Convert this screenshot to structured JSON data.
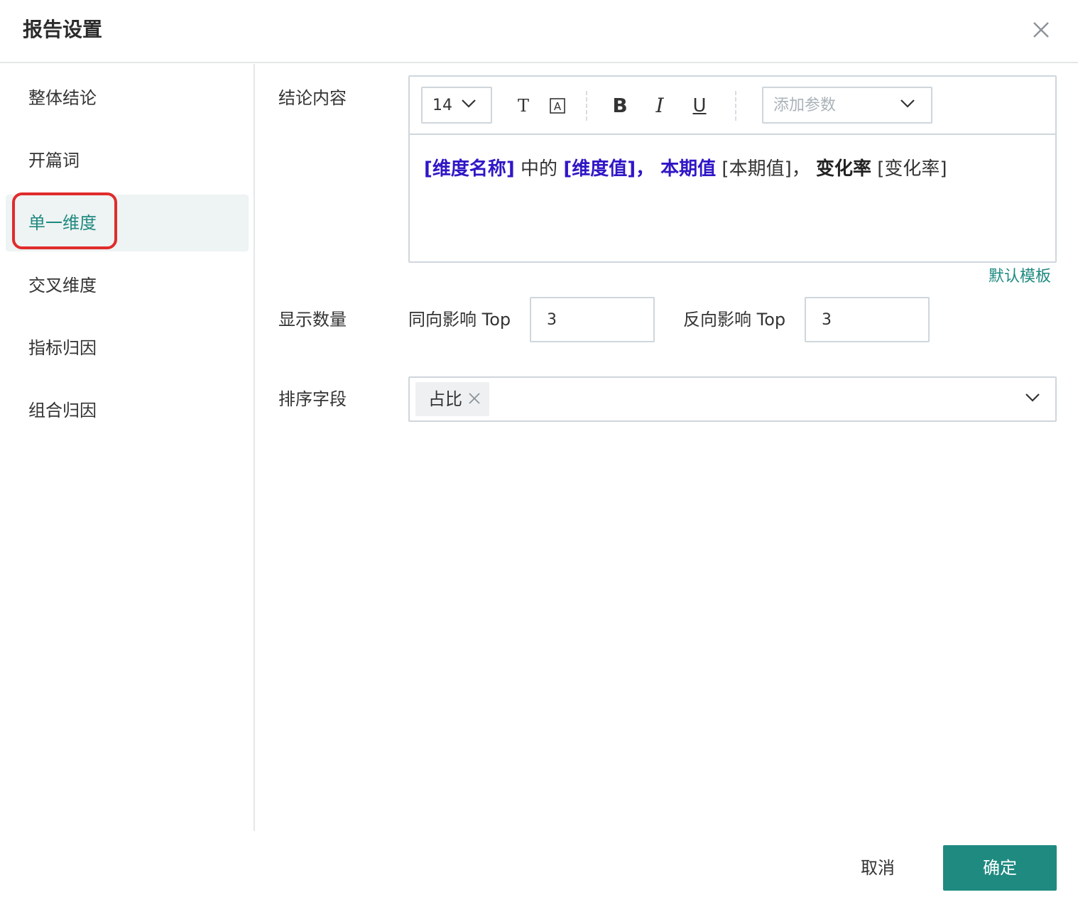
{
  "dialog": {
    "title": "报告设置",
    "close_icon": "close-icon"
  },
  "sidebar": {
    "active_index": 2,
    "items": [
      {
        "label": "整体结论"
      },
      {
        "label": "开篇词"
      },
      {
        "label": "单一维度"
      },
      {
        "label": "交叉维度"
      },
      {
        "label": "指标归因"
      },
      {
        "label": "组合归因"
      }
    ]
  },
  "form": {
    "conclusion": {
      "label": "结论内容",
      "toolbar": {
        "font_size": "14",
        "text_color_icon": "T",
        "bg_color_icon": "A",
        "bold": "B",
        "italic": "I",
        "underline": "U",
        "param_placeholder": "添加参数"
      },
      "content": [
        {
          "text": "[维度名称]",
          "style": "param"
        },
        {
          "text": " 中的 ",
          "style": "normal"
        },
        {
          "text": "[维度值]，",
          "style": "param"
        },
        {
          "text": " 本期值",
          "style": "param"
        },
        {
          "text": " [本期值]， ",
          "style": "normal"
        },
        {
          "text": "变化率",
          "style": "bold"
        },
        {
          "text": " [变化率]",
          "style": "normal"
        }
      ],
      "default_template": "默认模板"
    },
    "display_count": {
      "label": "显示数量",
      "positive_label": "同向影响 Top",
      "positive_value": "3",
      "negative_label": "反向影响 Top",
      "negative_value": "3"
    },
    "sort_field": {
      "label": "排序字段",
      "selected_tag": "占比"
    }
  },
  "footer": {
    "cancel_label": "取消",
    "ok_label": "确定"
  },
  "colors": {
    "accent": "#1f8a80",
    "param": "#2f16c6",
    "highlight_border": "#e02b2b"
  }
}
